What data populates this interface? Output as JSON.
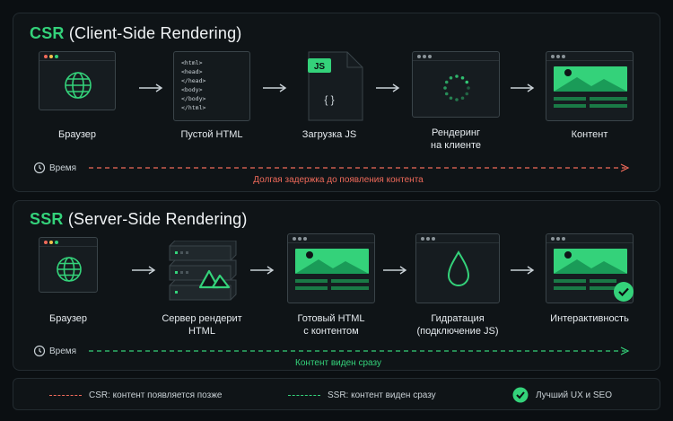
{
  "csr": {
    "title_abbr": "CSR",
    "title_rest": "(Client-Side Rendering)",
    "steps": [
      "Браузер",
      "Пустой HTML",
      "Загрузка JS",
      "Рендеринг\nна клиенте",
      "Контент"
    ],
    "time_label": "Время",
    "note": "Долгая задержка до появления контента",
    "note_color": "#f06a5a",
    "js_badge": "JS",
    "js_braces": "{ }",
    "html_code": [
      "<html>",
      "  <head>",
      "  </head>",
      "  <body>",
      "  </body>",
      "</html>"
    ]
  },
  "ssr": {
    "title_abbr": "SSR",
    "title_rest": "(Server-Side Rendering)",
    "steps": [
      "Браузер",
      "Сервер рендерит\nHTML",
      "Готовый HTML\nс контентом",
      "Гидратация\n(подключение JS)",
      "Интерактивность"
    ],
    "time_label": "Время",
    "note": "Контент виден сразу",
    "note_color": "#34d27a"
  },
  "legend": {
    "csr": "CSR: контент появляется позже",
    "ssr": "SSR: контент виден сразу",
    "best": "Лучший UX и SEO"
  },
  "colors": {
    "accent": "#34d27a",
    "red": "#f06a5a",
    "bg": "#0b0f12"
  },
  "icons": [
    "globe-icon",
    "code-icon",
    "js-file-icon",
    "spinner-icon",
    "image-content-icon",
    "server-icon",
    "nuxt-logo-icon",
    "drop-icon",
    "check-icon",
    "clock-icon"
  ]
}
